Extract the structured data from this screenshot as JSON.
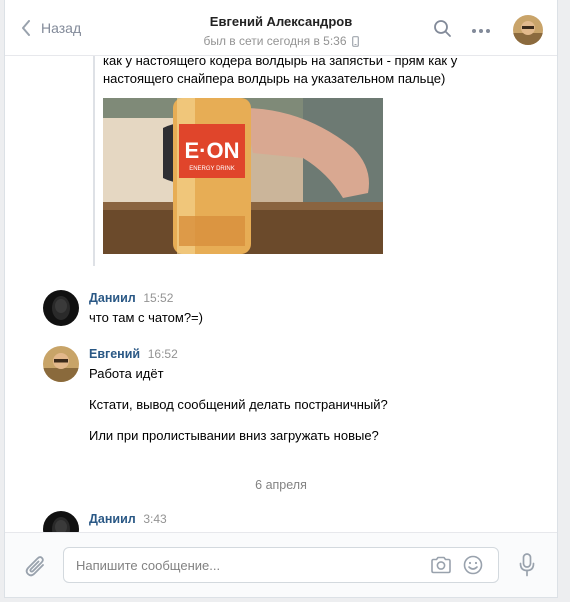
{
  "header": {
    "back_label": "Назад",
    "peer_name": "Евгений Александров",
    "peer_status": "был в сети сегодня в 5:36"
  },
  "forwarded": {
    "lines": [
      "как у настоящего кодера волдырь на запястьи - прям как у",
      "настоящего снайпера волдырь на указательном пальце)"
    ],
    "photo_text": {
      "brand": "E·ON",
      "sub": "ENERGY DRINK"
    }
  },
  "messages": [
    {
      "author": "Даниил",
      "time": "15:52",
      "lines": [
        "что там с чатом?=)"
      ]
    },
    {
      "author": "Евгений",
      "time": "16:52",
      "lines": [
        "Работа идёт",
        "Кстати, вывод сообщений делать постраничный?",
        "Или при пролистывании вниз загружать новые?"
      ]
    },
    {
      "author": "Даниил",
      "time": "3:43",
      "lines": []
    }
  ],
  "date_separator": "6 апреля",
  "composer": {
    "placeholder": "Напишите сообщение..."
  }
}
